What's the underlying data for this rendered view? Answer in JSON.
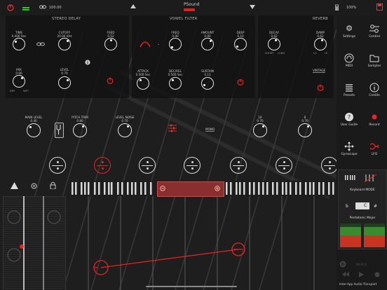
{
  "topbar": {
    "cpu_label": "100.00",
    "title": "PSound",
    "battery": "100%"
  },
  "delay": {
    "title": "STEREO DELAY",
    "time": {
      "label": "TIME",
      "value": "0.400 Sec"
    },
    "cutoff": {
      "label": "CUTOFF",
      "value": "20.00 kHz"
    },
    "feed": {
      "label": "FEED",
      "value": "0.52"
    },
    "mix": {
      "label": "MIX",
      "value": "0.66",
      "min": "DRY",
      "max": "WET"
    },
    "level": {
      "label": "LEVEL",
      "value": "0.70"
    }
  },
  "filter": {
    "title": "VOWEL FILTER",
    "freq": {
      "label": "FREQ",
      "value": "0.00"
    },
    "amount": {
      "label": "AMOUNT",
      "value": "0.90"
    },
    "deep": {
      "label": "DEEP",
      "value": "0.10"
    },
    "attack": {
      "label": "ATTACK",
      "value": "0.500 Sec"
    },
    "decrel": {
      "label": "DEC/REL",
      "value": "0.500 Sec"
    },
    "sustain": {
      "label": "SUSTAIN",
      "value": "0.11"
    },
    "dash": "-"
  },
  "reverb": {
    "title": "REVERB",
    "decay": {
      "label": "DECAY",
      "value": "0.62",
      "min": "SHORT",
      "max": "LONG"
    },
    "damp": {
      "label": "DAMP",
      "value": "0.62",
      "min": "LO",
      "max": "HI"
    },
    "vintage": "VINTAGE"
  },
  "row": {
    "main": {
      "label": "MAIN LEVEL",
      "value": "0.40"
    },
    "pitch": {
      "label": "PITCH TRIM",
      "value": "0.80"
    },
    "noise": {
      "label": "LEVEL NOISE",
      "value": "0.70"
    },
    "k16": {
      "label": "16",
      "value": "0.70"
    },
    "k8": {
      "label": "8",
      "value": "0.70"
    },
    "mono": "MONO"
  },
  "sidebar": [
    {
      "label": "Settings",
      "icon": "gear-icon"
    },
    {
      "label": "Control",
      "icon": "sliders-icon"
    },
    {
      "label": "MIDI",
      "icon": "midi-icon"
    },
    {
      "label": "Samples",
      "icon": "folder-icon"
    },
    {
      "label": "Presets",
      "icon": "list-icon"
    },
    {
      "label": "Credits",
      "icon": "info-icon"
    },
    {
      "label": "User Guide",
      "icon": "question-icon"
    },
    {
      "label": "Record",
      "icon": "record-icon"
    },
    {
      "label": "Gyroscope",
      "icon": "move-icon"
    },
    {
      "label": "LFO",
      "icon": "wave-icon"
    }
  ],
  "keymode": {
    "title": "Keyboard MODE",
    "note": "C",
    "scale": "Pentatonic Major",
    "flat": "b",
    "sharp": "#"
  },
  "transport": {
    "time": "00:00.0",
    "label": "Inter-App Audio Transport"
  },
  "colors": {
    "accent": "#e21b1b"
  }
}
